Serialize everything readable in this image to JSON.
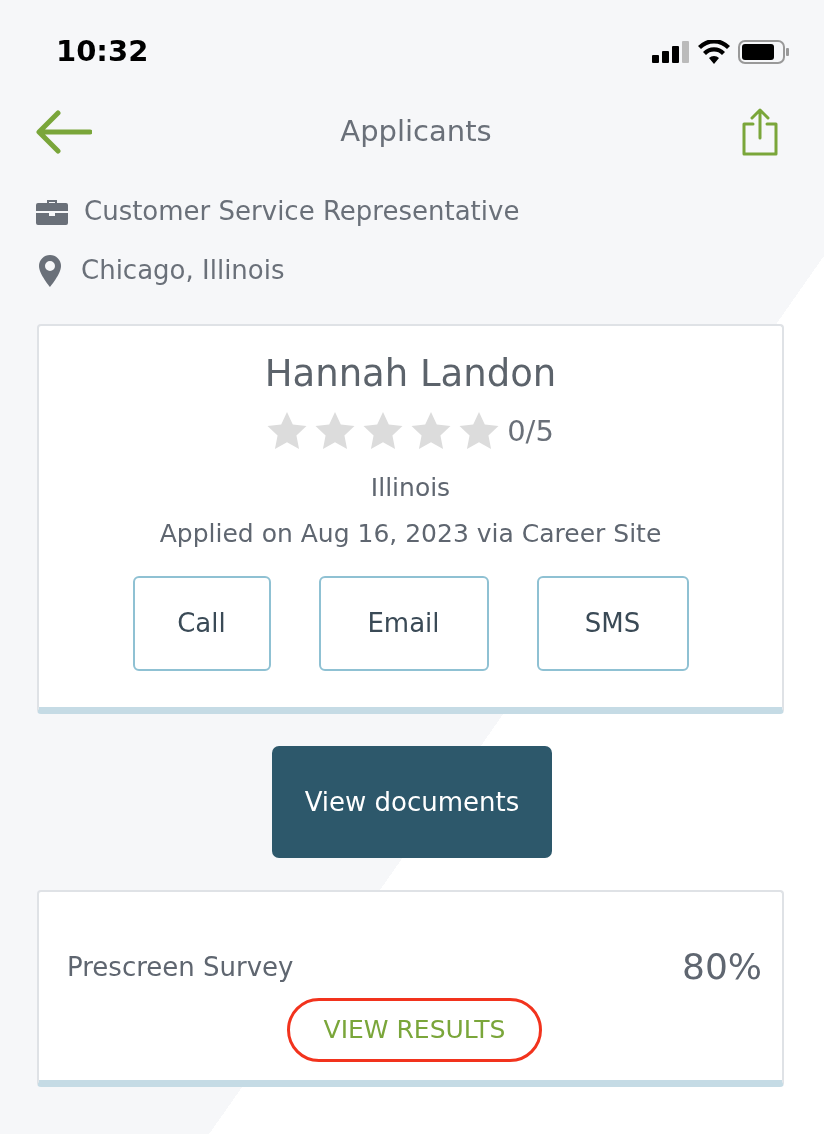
{
  "status_bar": {
    "time": "10:32"
  },
  "header": {
    "title": "Applicants"
  },
  "job": {
    "title": "Customer Service Representative",
    "location": "Chicago, Illinois"
  },
  "applicant": {
    "name": "Hannah Landon",
    "stars": 0,
    "rating": "0/5",
    "region": "Illinois",
    "applied": "Applied on Aug 16, 2023 via Career Site",
    "actions": [
      "Call",
      "Email",
      "SMS"
    ]
  },
  "documents_button": "View documents",
  "survey": {
    "name": "Prescreen Survey",
    "score": "80%",
    "link": "VIEW RESULTS",
    "highlighted": true
  }
}
